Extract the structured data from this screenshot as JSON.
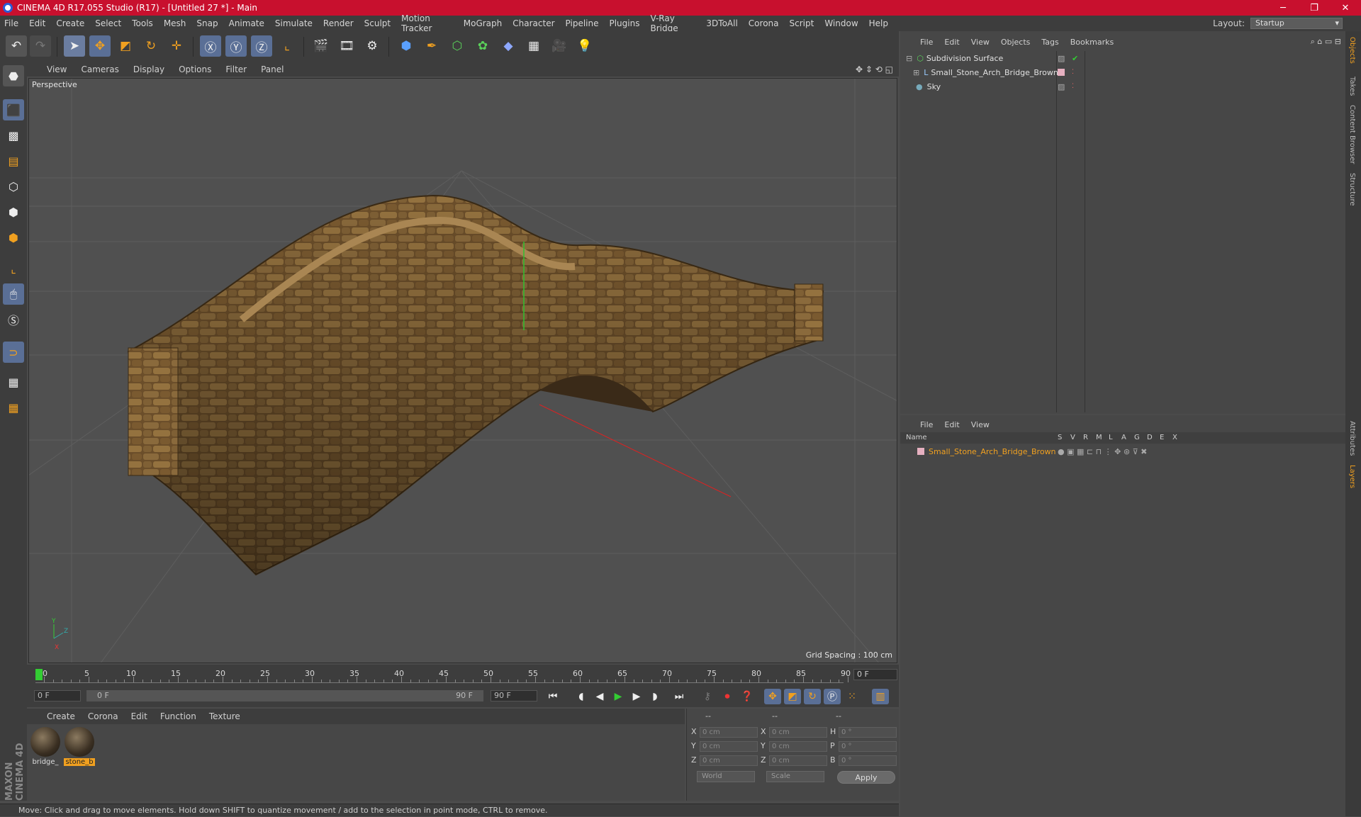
{
  "title": "CINEMA 4D R17.055 Studio (R17) - [Untitled 27 *] - Main",
  "window_controls": [
    "─",
    "❐",
    "✕"
  ],
  "menu": [
    "File",
    "Edit",
    "Create",
    "Select",
    "Tools",
    "Mesh",
    "Snap",
    "Animate",
    "Simulate",
    "Render",
    "Sculpt",
    "Motion Tracker",
    "MoGraph",
    "Character",
    "Pipeline",
    "Plugins",
    "V-Ray Bridge",
    "3DToAll",
    "Corona",
    "Script",
    "Window",
    "Help"
  ],
  "layout": {
    "label": "Layout:",
    "value": "Startup"
  },
  "viewport": {
    "menu": [
      "View",
      "Cameras",
      "Display",
      "Options",
      "Filter",
      "Panel"
    ],
    "label": "Perspective",
    "grid_spacing": "Grid Spacing : 100 cm"
  },
  "timeline": {
    "ticks": [
      "0",
      "5",
      "10",
      "15",
      "20",
      "25",
      "30",
      "35",
      "40",
      "45",
      "50",
      "55",
      "60",
      "65",
      "70",
      "75",
      "80",
      "85",
      "90"
    ],
    "current_frame": "0 F",
    "start_field": "0 F",
    "range_start": "0 F",
    "range_end": "90 F",
    "end_field": "90 F"
  },
  "materials": {
    "menu": [
      "Create",
      "Corona",
      "Edit",
      "Function",
      "Texture"
    ],
    "items": [
      {
        "name": "bridge_"
      },
      {
        "name": "stone_b"
      }
    ]
  },
  "coords": {
    "headers": [
      "--",
      "--",
      "--"
    ],
    "rows": [
      {
        "a": "X",
        "av": "0 cm",
        "b": "X",
        "bv": "0 cm",
        "c": "H",
        "cv": "0 °"
      },
      {
        "a": "Y",
        "av": "0 cm",
        "b": "Y",
        "bv": "0 cm",
        "c": "P",
        "cv": "0 °"
      },
      {
        "a": "Z",
        "av": "0 cm",
        "b": "Z",
        "bv": "0 cm",
        "c": "B",
        "cv": "0 °"
      }
    ],
    "mode1": "World",
    "mode2": "Scale",
    "apply": "Apply"
  },
  "objects": {
    "menu": [
      "File",
      "Edit",
      "View",
      "Objects",
      "Tags",
      "Bookmarks"
    ],
    "items": [
      {
        "name": "Subdivision Surface"
      },
      {
        "name": "Small_Stone_Arch_Bridge_Brown"
      },
      {
        "name": "Sky"
      }
    ]
  },
  "layers": {
    "menu": [
      "File",
      "Edit",
      "View"
    ],
    "header_name": "Name",
    "columns": [
      "S",
      "V",
      "R",
      "M",
      "L",
      "A",
      "G",
      "D",
      "E",
      "X"
    ],
    "items": [
      {
        "name": "Small_Stone_Arch_Bridge_Brown"
      }
    ]
  },
  "side_tabs": [
    "Objects",
    "Takes",
    "Content Browser",
    "Structure",
    "Attributes",
    "Layers"
  ],
  "brand": "MAXON CINEMA 4D",
  "status": "Move: Click and drag to move elements. Hold down SHIFT to quantize movement / add to the selection in point mode, CTRL to remove.",
  "colors": {
    "title_bar": "#c8102e",
    "accent_orange": "#f0a020",
    "bg": "#4b4b4b"
  }
}
